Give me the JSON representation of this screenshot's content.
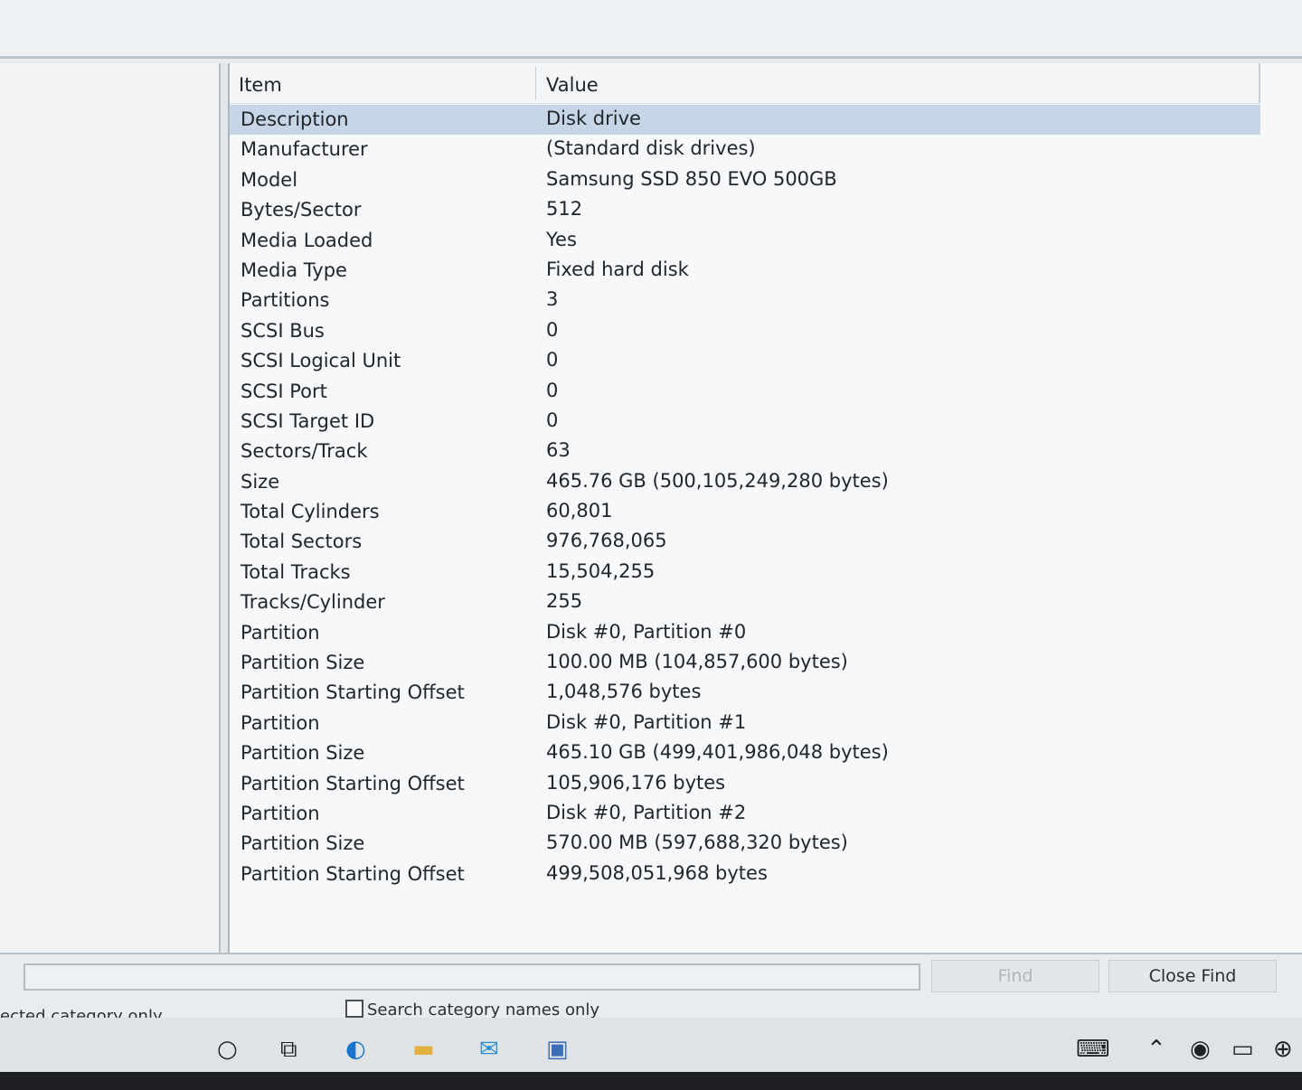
{
  "list": {
    "columns": {
      "item": "Item",
      "value": "Value"
    },
    "rows": [
      {
        "item": "Description",
        "value": "Disk drive"
      },
      {
        "item": "Manufacturer",
        "value": "(Standard disk drives)"
      },
      {
        "item": "Model",
        "value": "Samsung SSD 850 EVO 500GB"
      },
      {
        "item": "Bytes/Sector",
        "value": "512"
      },
      {
        "item": "Media Loaded",
        "value": "Yes"
      },
      {
        "item": "Media Type",
        "value": "Fixed hard disk"
      },
      {
        "item": "Partitions",
        "value": "3"
      },
      {
        "item": "SCSI Bus",
        "value": "0"
      },
      {
        "item": "SCSI Logical Unit",
        "value": "0"
      },
      {
        "item": "SCSI Port",
        "value": "0"
      },
      {
        "item": "SCSI Target ID",
        "value": "0"
      },
      {
        "item": "Sectors/Track",
        "value": "63"
      },
      {
        "item": "Size",
        "value": "465.76 GB (500,105,249,280 bytes)"
      },
      {
        "item": "Total Cylinders",
        "value": "60,801"
      },
      {
        "item": "Total Sectors",
        "value": "976,768,065"
      },
      {
        "item": "Total Tracks",
        "value": "15,504,255"
      },
      {
        "item": "Tracks/Cylinder",
        "value": "255"
      },
      {
        "item": "Partition",
        "value": "Disk #0, Partition #0"
      },
      {
        "item": "Partition Size",
        "value": "100.00 MB (104,857,600 bytes)"
      },
      {
        "item": "Partition Starting Offset",
        "value": "1,048,576 bytes"
      },
      {
        "item": "Partition",
        "value": "Disk #0, Partition #1"
      },
      {
        "item": "Partition Size",
        "value": "465.10 GB (499,401,986,048 bytes)"
      },
      {
        "item": "Partition Starting Offset",
        "value": "105,906,176 bytes"
      },
      {
        "item": "Partition",
        "value": "Disk #0, Partition #2"
      },
      {
        "item": "Partition Size",
        "value": "570.00 MB (597,688,320 bytes)"
      },
      {
        "item": "Partition Starting Offset",
        "value": "499,508,051,968 bytes"
      }
    ]
  },
  "find": {
    "find_label": "Find",
    "close_find_label": "Close Find",
    "selected_category_label": "ected category only",
    "search_names_label": "Search category names only",
    "search_names_checked": false
  },
  "taskbar": {
    "icons": [
      "search-circle-icon",
      "task-view-icon",
      "edge-icon",
      "file-explorer-icon",
      "mail-icon",
      "system-info-icon",
      "keyboard-icon",
      "chevron-up-icon",
      "meet-icon",
      "battery-icon",
      "network-icon"
    ]
  }
}
